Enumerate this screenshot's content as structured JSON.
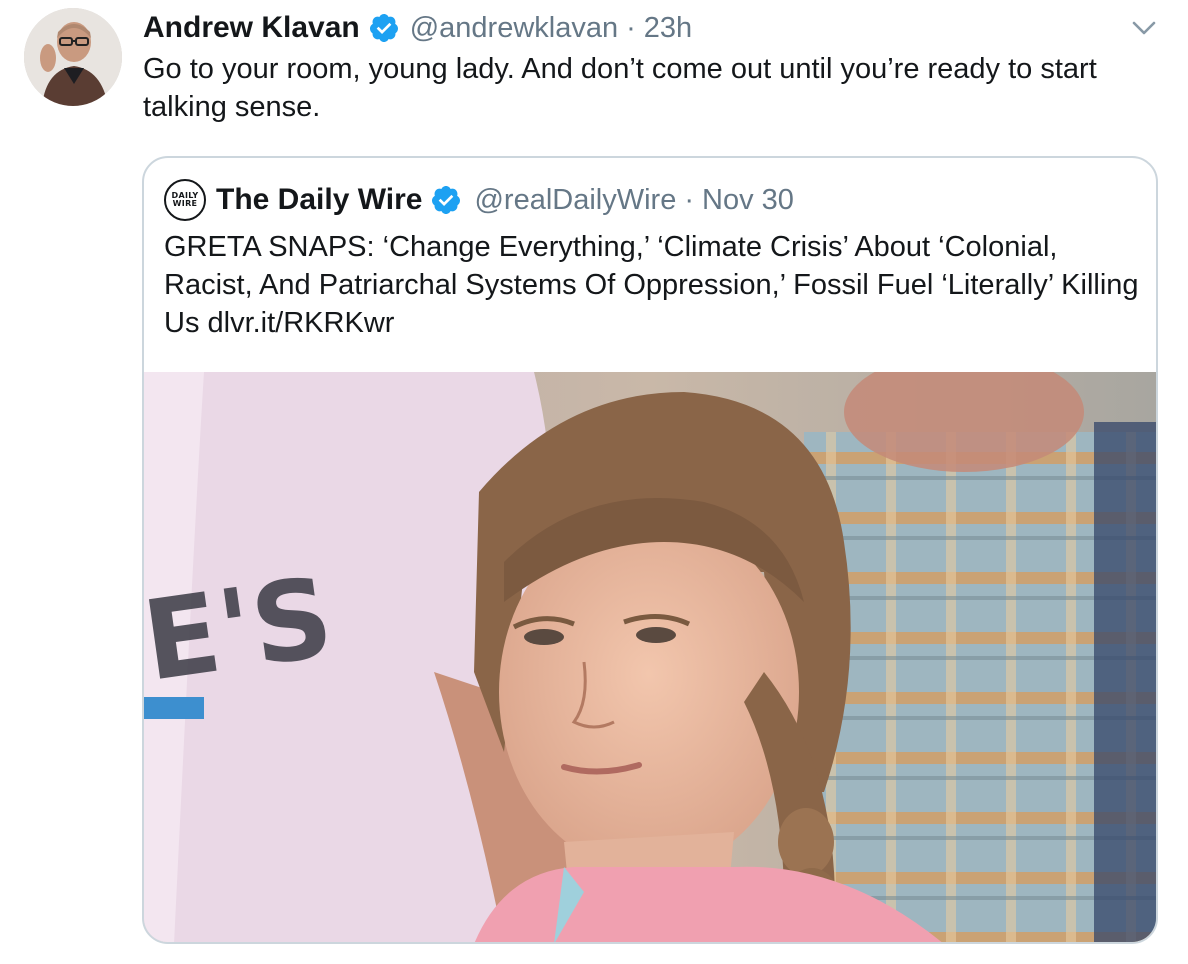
{
  "tweet": {
    "author": {
      "display_name": "Andrew Klavan",
      "handle": "@andrewklavan",
      "verified": true
    },
    "separator": "·",
    "timestamp": "23h",
    "text": "Go to your room, young lady. And don’t come out until you’re ready to start talking sense.",
    "menu_icon": "chevron-down-icon"
  },
  "quoted_tweet": {
    "author": {
      "display_name": "The Daily Wire",
      "handle": "@realDailyWire",
      "verified": true,
      "logo_lines": [
        "DAILY",
        "WIRE"
      ]
    },
    "separator": "·",
    "date": "Nov 30",
    "text": "GRETA SNAPS: ‘Change Everything,’ ‘Climate Crisis’ About ‘Colonial, Racist, And Patriarchal Systems Of Oppression,’ Fossil Fuel ‘Literally’ Killing Us dlvr.it/RKRKwr",
    "media": {
      "type": "photo",
      "shirt_lettering": "E'S"
    }
  },
  "colors": {
    "text_primary": "#14171a",
    "text_secondary": "#657786",
    "verified_blue": "#1da1f2",
    "border": "#ccd6dd"
  }
}
